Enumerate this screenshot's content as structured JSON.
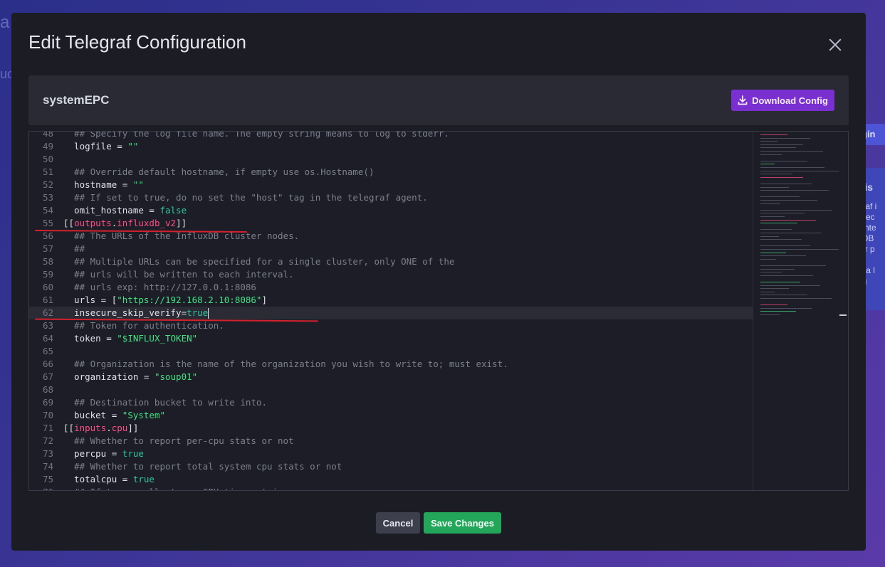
{
  "modal": {
    "title": "Edit Telegraf Configuration",
    "config_name": "systemEPC",
    "download_label": "Download Config",
    "cancel_label": "Cancel",
    "save_label": "Save Changes"
  },
  "background": {
    "left_fragment_1": "a",
    "left_fragment_2": "uc",
    "right_button": "gin",
    "right_panel_heading": "at is",
    "right_panel_lines": [
      "egraf i",
      "collec",
      "m inte",
      "uxDB",
      "ther p",
      "",
      "e's a l",
      "ting"
    ]
  },
  "editor": {
    "lines": [
      {
        "n": "48",
        "html": "<span class=\"cm\">  ## Specify the log file name. The empty string means to log to stderr.</span>"
      },
      {
        "n": "49",
        "html": "  logfile = <span class=\"st\">\"\"</span>"
      },
      {
        "n": "50",
        "html": ""
      },
      {
        "n": "51",
        "html": "<span class=\"cm\">  ## Override default hostname, if empty use os.Hostname()</span>"
      },
      {
        "n": "52",
        "html": "  hostname = <span class=\"st\">\"\"</span>"
      },
      {
        "n": "53",
        "html": "<span class=\"cm\">  ## If set to true, do no set the \"host\" tag in the telegraf agent.</span>"
      },
      {
        "n": "54",
        "html": "  omit_hostname = <span class=\"kw\">false</span>"
      },
      {
        "n": "55",
        "html": "[[<span class=\"sec\">outputs</span>.<span class=\"sec\">influxdb_v2</span>]]"
      },
      {
        "n": "56",
        "html": "<span class=\"cm\">  ## The URLs of the InfluxDB cluster nodes.</span>"
      },
      {
        "n": "57",
        "html": "<span class=\"cm\">  ##</span>"
      },
      {
        "n": "58",
        "html": "<span class=\"cm\">  ## Multiple URLs can be specified for a single cluster, only ONE of the</span>"
      },
      {
        "n": "59",
        "html": "<span class=\"cm\">  ## urls will be written to each interval.</span>"
      },
      {
        "n": "60",
        "html": "<span class=\"cm\">  ## urls exp: http://127.0.0.1:8086</span>"
      },
      {
        "n": "61",
        "html": "  urls = [<span class=\"st\">\"https://192.168.2.10:8086\"</span>]"
      },
      {
        "n": "62",
        "html": "  insecure_skip_verify=<span class=\"kw\">true</span><span class=\"cursor\"></span>",
        "active": true
      },
      {
        "n": "63",
        "html": "<span class=\"cm\">  ## Token for authentication.</span>"
      },
      {
        "n": "64",
        "html": "  token = <span class=\"st\">\"$INFLUX_TOKEN\"</span>"
      },
      {
        "n": "65",
        "html": ""
      },
      {
        "n": "66",
        "html": "<span class=\"cm\">  ## Organization is the name of the organization you wish to write to; must exist.</span>"
      },
      {
        "n": "67",
        "html": "  organization = <span class=\"st\">\"soup01\"</span>"
      },
      {
        "n": "68",
        "html": ""
      },
      {
        "n": "69",
        "html": "<span class=\"cm\">  ## Destination bucket to write into.</span>"
      },
      {
        "n": "70",
        "html": "  bucket = <span class=\"st\">\"System\"</span>"
      },
      {
        "n": "71",
        "html": "[[<span class=\"sec\">inputs</span>.<span class=\"sec\">cpu</span>]]"
      },
      {
        "n": "72",
        "html": "<span class=\"cm\">  ## Whether to report per-cpu stats or not</span>"
      },
      {
        "n": "73",
        "html": "  percpu = <span class=\"kw\">true</span>"
      },
      {
        "n": "74",
        "html": "<span class=\"cm\">  ## Whether to report total system cpu stats or not</span>"
      },
      {
        "n": "75",
        "html": "  totalcpu = <span class=\"kw\">true</span>"
      },
      {
        "n": "76",
        "html": "<span class=\"cm\">  ## If true, collect raw CPU time metrics</span>"
      }
    ]
  },
  "colors": {
    "download_button": "#7a2fd0",
    "save_button": "#23a65a",
    "annotation_red": "#d3222e",
    "keyword_teal": "#31c8a0",
    "string_green": "#45e384",
    "section_pink": "#ff4f88"
  },
  "icons": {
    "download": "download-icon",
    "close": "close-icon"
  }
}
